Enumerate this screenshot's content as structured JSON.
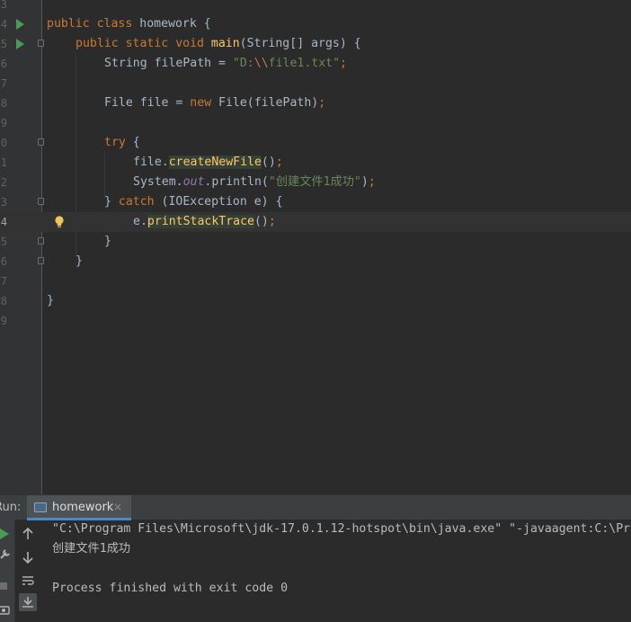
{
  "editor": {
    "lines": [
      {
        "num": "3",
        "text": ""
      },
      {
        "num": "4",
        "text": "public class homework {"
      },
      {
        "num": "5",
        "text": "public static void main(String[] args) {"
      },
      {
        "num": "6",
        "text": "String filePath = \"D:\\\\file1.txt\";"
      },
      {
        "num": "7",
        "text": ""
      },
      {
        "num": "8",
        "text": "File file = new File(filePath);"
      },
      {
        "num": "9",
        "text": ""
      },
      {
        "num": "0",
        "text": "try {"
      },
      {
        "num": "1",
        "text": "file.createNewFile();"
      },
      {
        "num": "2",
        "text": "System.out.println(\"创建文件1成功\");"
      },
      {
        "num": "3",
        "text": "} catch (IOException e) {"
      },
      {
        "num": "4",
        "text": "e.printStackTrace();"
      },
      {
        "num": "5",
        "text": "}"
      },
      {
        "num": "6",
        "text": "}"
      },
      {
        "num": "7",
        "text": ""
      },
      {
        "num": "8",
        "text": "}"
      },
      {
        "num": "9",
        "text": ""
      }
    ],
    "tokens": {
      "l4": {
        "kw1": "public",
        "kw2": "class",
        "name": "homework",
        "brace": "{"
      },
      "l5": {
        "kw1": "public",
        "kw2": "static",
        "kw3": "void",
        "fn": "main",
        "rest": "(String[] args) {"
      },
      "l6": {
        "pre": "String filePath = ",
        "s1": "\"D:",
        "esc": "\\\\",
        "s2": "file1.txt\"",
        "semi": ";"
      },
      "l8": {
        "pre": "File file = ",
        "kw": "new",
        "mid": " File(filePath)",
        "semi": ";"
      },
      "l10": {
        "kw": "try",
        "rest": " {"
      },
      "l11": {
        "pre": "file.",
        "fn": "createNewFile",
        "rest": "()",
        "semi": ";"
      },
      "l12": {
        "pre": "System.",
        "field": "out",
        "mid": ".println(",
        "str": "\"创建文件1成功\"",
        "rest": ")",
        "semi": ";"
      },
      "l13": {
        "pre": "} ",
        "kw": "catch",
        "rest": " (IOException e) {"
      },
      "l14": {
        "pre": "e.",
        "fn": "printStackTrace",
        "rest": "()",
        "semi": ";"
      },
      "l15": {
        "text": "}"
      },
      "l16": {
        "text": "}"
      },
      "l18": {
        "text": "}"
      }
    },
    "icons": {
      "run": "run-gutter-icon",
      "fold": "fold-marker-icon",
      "bulb": "intention-bulb-icon"
    },
    "colors": {
      "keyword": "#cc7832",
      "function": "#ffc66d",
      "string": "#6a8759",
      "field": "#9876aa",
      "text": "#a9b7c6"
    }
  },
  "run_panel": {
    "label": "Run:",
    "tab_label": "homework",
    "tab_close": "×",
    "console_lines": [
      "\"C:\\Program Files\\Microsoft\\jdk-17.0.1.12-hotspot\\bin\\java.exe\" \"-javaagent:C:\\Pr",
      "创建文件1成功",
      "",
      "Process finished with exit code 0"
    ]
  }
}
